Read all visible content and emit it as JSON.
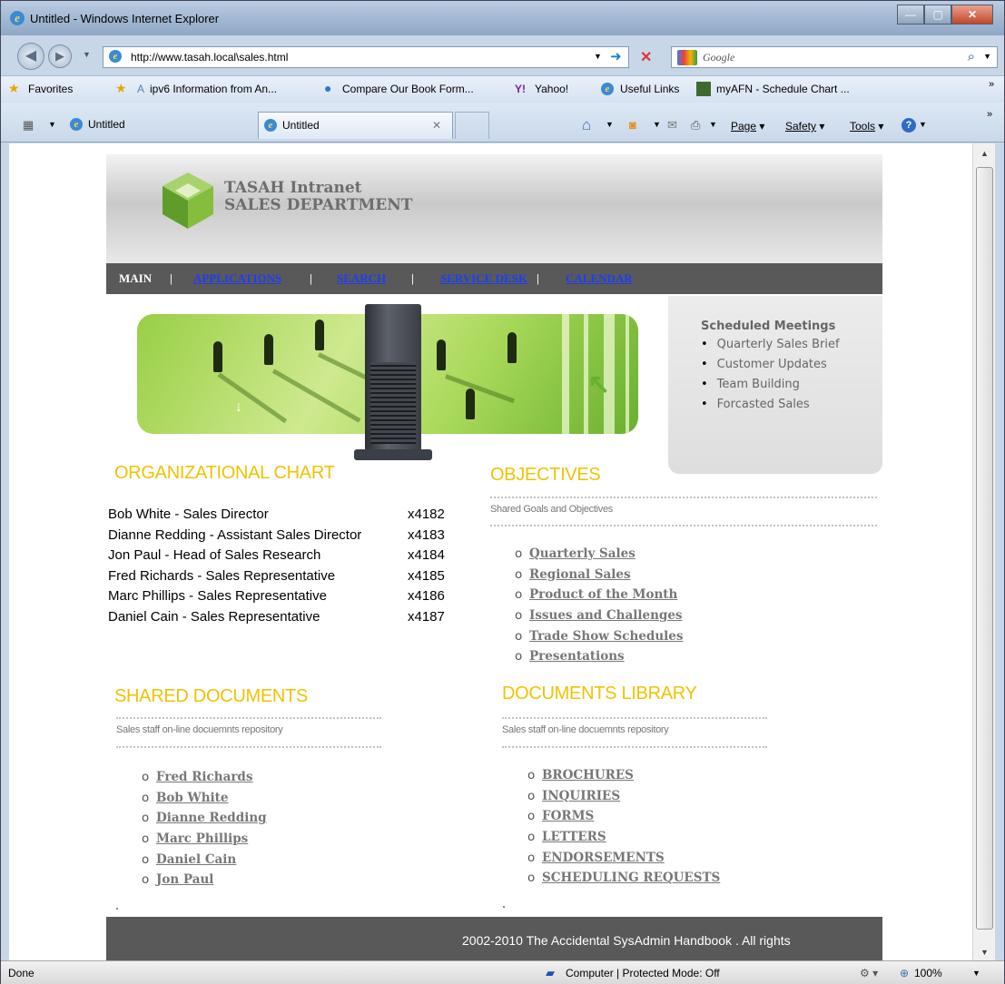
{
  "window": {
    "title": "Untitled - Windows Internet Explorer"
  },
  "address": {
    "url": "http://www.tasah.local\\sales.html",
    "search_placeholder": "Google"
  },
  "favorites": {
    "label": "Favorites",
    "items": [
      "ipv6 Information from An...",
      "Compare Our Book Form...",
      "Yahoo!",
      "Useful Links",
      "myAFN - Schedule Chart ..."
    ]
  },
  "tabs": {
    "items": [
      "Untitled",
      "Untitled"
    ]
  },
  "commands": {
    "page": "Page",
    "safety": "Safety",
    "tools": "Tools"
  },
  "site": {
    "title_line1": "TASAH Intranet",
    "title_line2": "SALES DEPARTMENT",
    "nav": {
      "main": "MAIN",
      "applications": "APPLICATIONS",
      "search": "SEARCH",
      "service_desk": "SERVICE DESK",
      "calendar": "CALENDAR",
      "sep": "|"
    }
  },
  "meetings": {
    "title": "Scheduled Meetings",
    "items": [
      "Quarterly Sales Brief",
      "Customer Updates",
      "Team Building",
      "Forcasted Sales"
    ]
  },
  "org_chart": {
    "title": "ORGANIZATIONAL CHART",
    "rows": [
      {
        "name": "Bob White - Sales Director",
        "ext": "x4182"
      },
      {
        "name": "Dianne Redding - Assistant Sales Director",
        "ext": "x4183"
      },
      {
        "name": "Jon Paul - Head of Sales Research",
        "ext": "x4184"
      },
      {
        "name": "Fred Richards - Sales Representative",
        "ext": "x4185"
      },
      {
        "name": "Marc Phillips - Sales Representative",
        "ext": "x4186"
      },
      {
        "name": "Daniel Cain - Sales Representative",
        "ext": "x4187"
      }
    ]
  },
  "objectives": {
    "title": "OBJECTIVES",
    "subtitle": "Shared Goals and Objectives",
    "links": [
      "Quarterly Sales",
      "Regional Sales",
      "Product of the Month",
      "Issues and Challenges",
      "Trade Show Schedules",
      "Presentations"
    ]
  },
  "shared_docs": {
    "title": "SHARED DOCUMENTS",
    "subtitle": "Sales staff on-line docuemnts repository",
    "links": [
      "Fred Richards",
      "Bob White",
      "Dianne Redding",
      "Marc Phillips",
      "Daniel Cain",
      "Jon Paul"
    ]
  },
  "docs_library": {
    "title": "DOCUMENTS LIBRARY",
    "subtitle": "Sales staff on-line docuemnts repository",
    "links": [
      "BROCHURES",
      "INQUIRIES",
      "FORMS",
      "LETTERS",
      "ENDORSEMENTS",
      "SCHEDULING REQUESTS"
    ]
  },
  "footer": {
    "text": "2002-2010 The Accidental SysAdmin Handbook . All rights"
  },
  "status": {
    "left": "Done",
    "zone": "Computer | Protected Mode: Off",
    "zoom": "100%"
  },
  "colors": {
    "accent_yellow": "#f2c200",
    "nav_bg": "#595959",
    "link_blue": "#1d3ef5"
  }
}
